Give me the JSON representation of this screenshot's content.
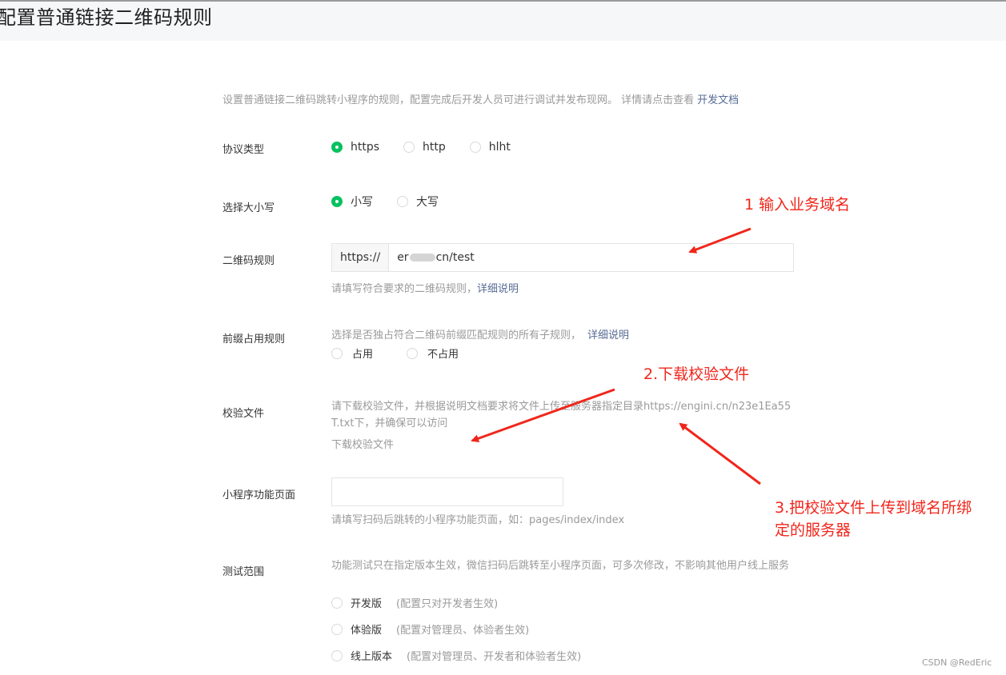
{
  "header": {
    "title": "配置普通链接二维码规则"
  },
  "intro": {
    "text": "设置普通链接二维码跳转小程序的规则，配置完成后开发人员可进行调试并发布现网。 详情请点击查看",
    "link": "开发文档"
  },
  "protocol": {
    "label": "协议类型",
    "options": [
      "https",
      "http",
      "hlht"
    ],
    "selected": "https"
  },
  "case": {
    "label": "选择大小写",
    "options": [
      "小写",
      "大写"
    ],
    "selected": "小写"
  },
  "qr_rule": {
    "label": "二维码规则",
    "prefix": "https://",
    "value_start": "er",
    "value_end": "cn/test",
    "hint": "请填写符合要求的二维码规则，",
    "hint_link": "详细说明"
  },
  "prefix_rule": {
    "label": "前缀占用规则",
    "hint": "选择是否独占符合二维码前缀匹配规则的所有子规则，",
    "hint_link": "详细说明",
    "options": [
      "占用",
      "不占用"
    ]
  },
  "verify_file": {
    "label": "校验文件",
    "hint": "请下载校验文件，并根据说明文档要求将文件上传至服务器指定目录https://engini.cn/n23e1Ea55T.txt下，并确保可以访问",
    "download_link": "下载校验文件"
  },
  "mp_page": {
    "label": "小程序功能页面",
    "value": "",
    "hint": "请填写扫码后跳转的小程序功能页面，如：pages/index/index"
  },
  "test_scope": {
    "label": "测试范围",
    "hint": "功能测试只在指定版本生效，微信扫码后跳转至小程序页面，可多次修改，不影响其他用户线上服务",
    "options": [
      {
        "name": "开发版",
        "desc": "(配置只对开发者生效)"
      },
      {
        "name": "体验版",
        "desc": "(配置对管理员、体验者生效)"
      },
      {
        "name": "线上版本",
        "desc": "(配置对管理员、开发者和体验者生效)"
      }
    ]
  },
  "annotations": {
    "step1": "1 输入业务域名",
    "step2": "2.下载校验文件",
    "step3_line1": "3.把校验文件上传到域名所绑",
    "step3_line2": "定的服务器"
  },
  "watermark": "CSDN @RedEric",
  "colors": {
    "accent": "#07c160",
    "link": "#576b95",
    "annotation": "#f0261b"
  }
}
